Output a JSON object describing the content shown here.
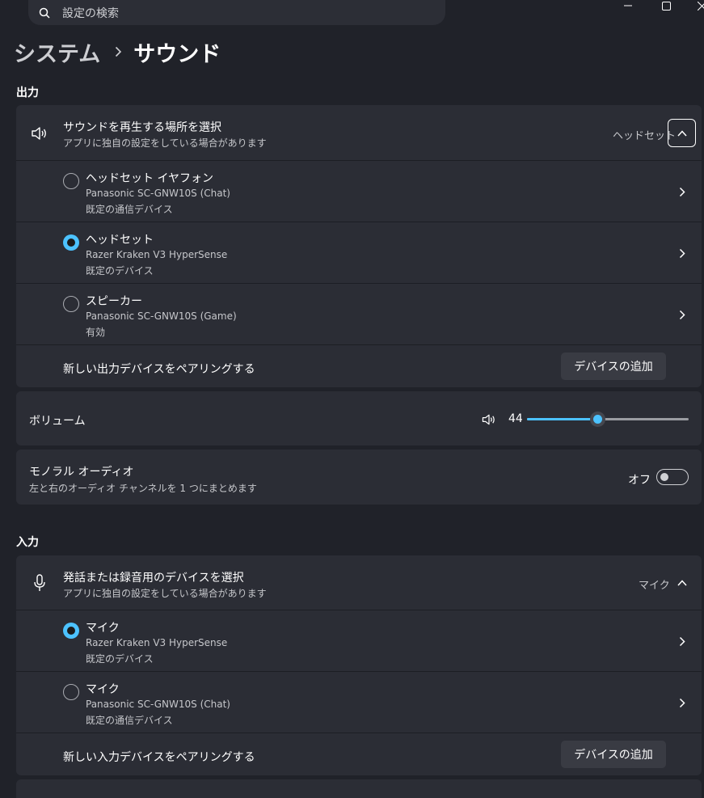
{
  "search": {
    "placeholder": "設定の検索"
  },
  "breadcrumb": {
    "parent": "システム",
    "current": "サウンド"
  },
  "output": {
    "section_label": "出力",
    "choose_title": "サウンドを再生する場所を選択",
    "choose_subtitle": "アプリに独自の設定をしている場合があります",
    "selected_value": "ヘッドセット",
    "devices": [
      {
        "name": "ヘッドセット イヤフォン",
        "model": "Panasonic SC-GNW10S (Chat)",
        "status": "既定の通信デバイス",
        "selected": false
      },
      {
        "name": "ヘッドセット",
        "model": "Razer Kraken V3 HyperSense",
        "status": "既定のデバイス",
        "selected": true
      },
      {
        "name": "スピーカー",
        "model": "Panasonic SC-GNW10S (Game)",
        "status": "有効",
        "selected": false
      }
    ],
    "pair_label": "新しい出力デバイスをペアリングする",
    "add_button": "デバイスの追加"
  },
  "volume": {
    "label": "ボリューム",
    "value": "44",
    "level": 0.44
  },
  "mono": {
    "title": "モノラル オーディオ",
    "subtitle": "左と右のオーディオ チャンネルを 1 つにまとめます",
    "state": "オフ"
  },
  "input": {
    "section_label": "入力",
    "choose_title": "発話または録音用のデバイスを選択",
    "choose_subtitle": "アプリに独自の設定をしている場合があります",
    "selected_value": "マイク",
    "devices": [
      {
        "name": "マイク",
        "model": "Razer Kraken V3 HyperSense",
        "status": "既定のデバイス",
        "selected": true
      },
      {
        "name": "マイク",
        "model": "Panasonic SC-GNW10S (Chat)",
        "status": "既定の通信デバイス",
        "selected": false
      }
    ],
    "pair_label": "新しい入力デバイスをペアリングする",
    "add_button": "デバイスの追加"
  },
  "colors": {
    "accent": "#4cc2ff",
    "background": "#202229",
    "card": "#2b2d35"
  }
}
